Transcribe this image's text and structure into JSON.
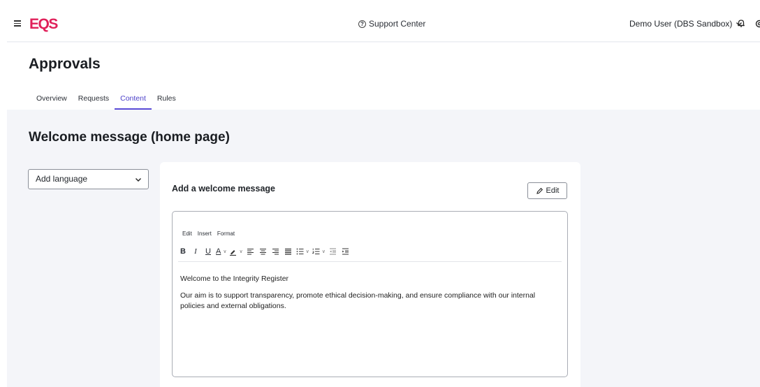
{
  "topbar": {
    "logo_text": "EQS",
    "brand_color": "#e0205a",
    "support_label": "Support Center",
    "user_label": "Demo User (DBS Sandbox)"
  },
  "page": {
    "title": "Approvals",
    "tabs": [
      {
        "label": "Overview",
        "active": false
      },
      {
        "label": "Requests",
        "active": false
      },
      {
        "label": "Content",
        "active": true
      },
      {
        "label": "Rules",
        "active": false
      }
    ],
    "accent_color": "#5a4bd6"
  },
  "section": {
    "title": "Welcome message (home page)",
    "language_select": "Add language"
  },
  "card": {
    "title": "Add a welcome message",
    "edit_label": "Edit",
    "editor": {
      "menu": [
        "Edit",
        "Insert",
        "Format"
      ],
      "toolbar_icons": [
        "bold-icon",
        "italic-icon",
        "underline-icon",
        "text-color-icon",
        "highlight-icon",
        "align-left-icon",
        "align-center-icon",
        "align-right-icon",
        "align-justify-icon",
        "bullet-list-icon",
        "numbered-list-icon",
        "outdent-icon",
        "indent-icon"
      ],
      "paragraph_1": "Welcome to the Integrity Register",
      "paragraph_2": "Our aim is to support transparency, promote ethical decision-making, and ensure compliance with our internal policies and external obligations."
    }
  }
}
